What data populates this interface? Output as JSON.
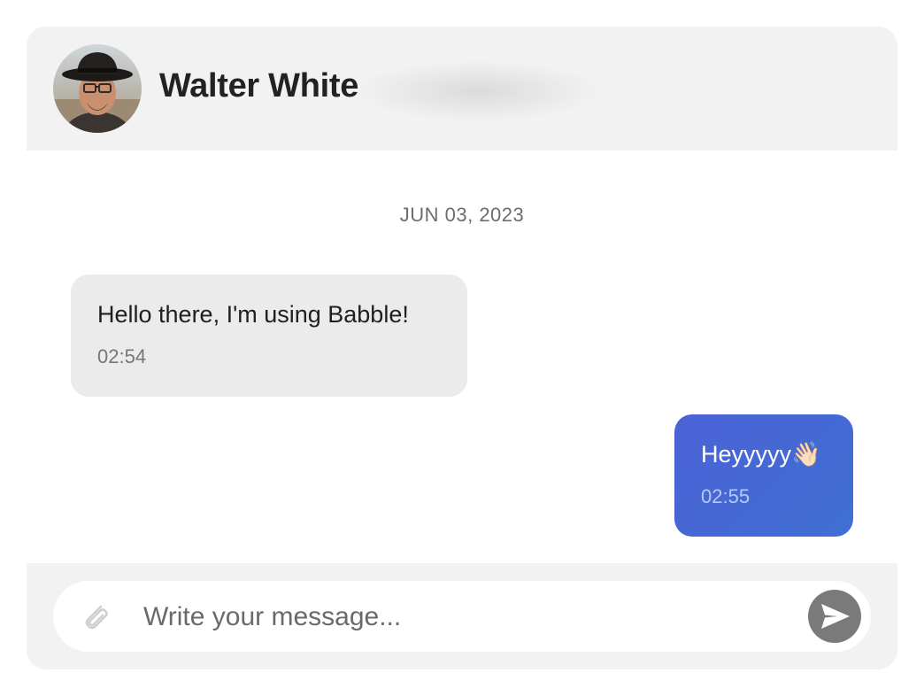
{
  "header": {
    "contact_name": "Walter White",
    "avatar_icon": "user-avatar-photo"
  },
  "conversation": {
    "date_divider": "JUN 03, 2023",
    "messages": [
      {
        "direction": "incoming",
        "text": "Hello there, I'm using Babble!",
        "time": "02:54"
      },
      {
        "direction": "outgoing",
        "text": "Heyyyyy👋🏻",
        "time": "02:55"
      }
    ]
  },
  "composer": {
    "placeholder": "Write your message...",
    "value": "",
    "attach_icon": "paperclip-icon",
    "send_icon": "send-icon"
  },
  "colors": {
    "header_bg": "#f2f2f2",
    "incoming_bubble": "#ebebeb",
    "outgoing_bubble": "#4567d4",
    "send_button": "#7a7a7a"
  }
}
